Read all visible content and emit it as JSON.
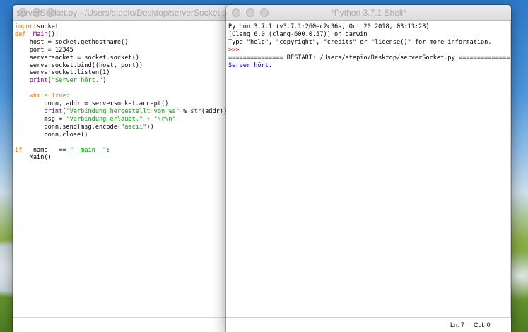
{
  "editor": {
    "title": "serverSocket.py - /Users/stepio/Desktop/serverSocket.py",
    "lines": [
      [
        [
          "kw",
          "import"
        ],
        [
          "",
          "socket"
        ]
      ],
      [
        [
          "kw",
          "def"
        ],
        [
          "",
          "  "
        ],
        [
          "bi",
          "Main"
        ],
        [
          "",
          "():"
        ]
      ],
      [
        [
          "",
          "    host = socket.gethostname()"
        ]
      ],
      [
        [
          "",
          "    port = 12345"
        ]
      ],
      [
        [
          "",
          "    serversocket = socket.socket()"
        ]
      ],
      [
        [
          "",
          "    serversocket.bind((host, port))"
        ]
      ],
      [
        [
          "",
          "    serversocket.listen(1)"
        ]
      ],
      [
        [
          "",
          "    "
        ],
        [
          "bi",
          "print"
        ],
        [
          "",
          "("
        ],
        [
          "st",
          "\"Server hört.\""
        ],
        [
          "",
          ")"
        ]
      ],
      [
        [
          "",
          ""
        ]
      ],
      [
        [
          "",
          "    "
        ],
        [
          "kw",
          "while"
        ],
        [
          "",
          ""
        ],
        [
          "kw",
          " True"
        ],
        [
          "",
          ":"
        ]
      ],
      [
        [
          "",
          "        conn, addr = serversocket.accept()"
        ]
      ],
      [
        [
          "",
          "        "
        ],
        [
          "bi",
          "print"
        ],
        [
          "",
          "("
        ],
        [
          "st",
          "\"Verbindung hergestellt von %s\""
        ],
        [
          "",
          " % "
        ],
        [
          "bi",
          "str"
        ],
        [
          "",
          "(addr))"
        ]
      ],
      [
        [
          "",
          "        msg = "
        ],
        [
          "st",
          "\"Verbindung erlaubt.\""
        ],
        [
          "",
          " + "
        ],
        [
          "st",
          "\"\\r\\n\""
        ]
      ],
      [
        [
          "",
          "        conn.send(msg.encode("
        ],
        [
          "st",
          "\"ascii\""
        ],
        [
          "",
          "))"
        ]
      ],
      [
        [
          "",
          "        conn.close()"
        ]
      ],
      [
        [
          "",
          ""
        ]
      ],
      [
        [
          "kw",
          "if"
        ],
        [
          "",
          " __name__ == "
        ],
        [
          "st",
          "\"__main__\""
        ],
        [
          "",
          ":"
        ]
      ],
      [
        [
          "",
          "    Main()"
        ]
      ]
    ]
  },
  "shell": {
    "title": "*Python 3.7.1 Shell*",
    "lines": [
      [
        [
          "",
          "Python 3.7.1 (v3.7.1:260ec2c36a, Oct 20 2018, 03:13:28)"
        ]
      ],
      [
        [
          "",
          "[Clang 6.0 (clang-600.0.57)] on darwin"
        ]
      ],
      [
        [
          "",
          "Type \"help\", \"copyright\", \"credits\" or \"license()\" for more information."
        ]
      ],
      [
        [
          "prompt",
          ">>>"
        ]
      ],
      [
        [
          "",
          "=============== RESTART: /Users/stepio/Desktop/serverSocket.py ==============="
        ]
      ],
      [
        [
          "out",
          "Server hört."
        ]
      ]
    ],
    "status_line": "Ln: 7",
    "status_col": "Col: 0"
  }
}
